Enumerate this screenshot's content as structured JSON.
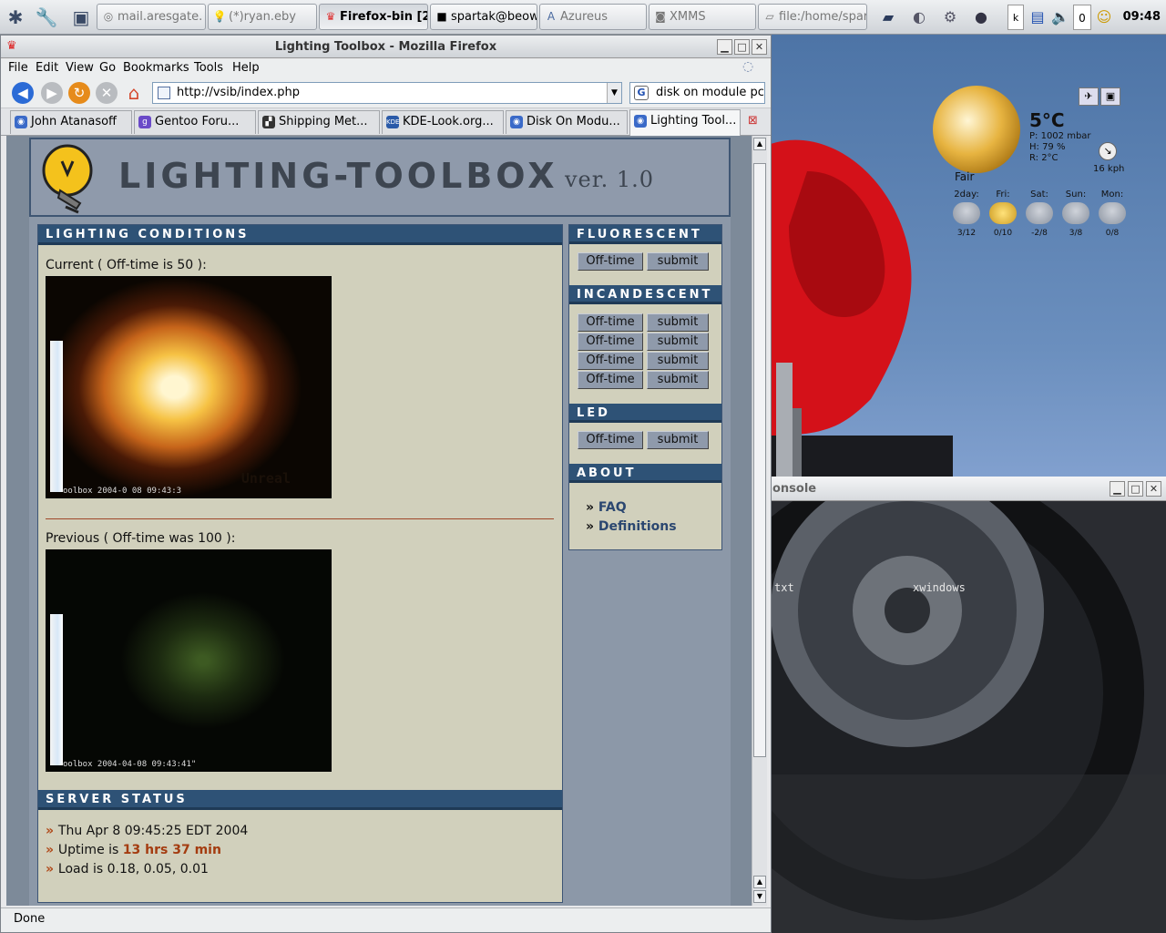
{
  "taskbar": {
    "tasks": [
      {
        "label": "mail.aresgate."
      },
      {
        "label": "(*)ryan.eby"
      },
      {
        "label": "Firefox-bin [2]"
      },
      {
        "label": "spartak@beow"
      },
      {
        "label": "Azureus"
      },
      {
        "label": "XMMS"
      },
      {
        "label": "file:/home/spar"
      }
    ],
    "tray_count": "0",
    "clock": "09:48"
  },
  "weather": {
    "temp": "5°C",
    "pressure": "P: 1002 mbar",
    "humidity": "H: 79 %",
    "feels": "R: 2°C",
    "wind": "16 kph",
    "condition": "Fair",
    "days": [
      {
        "name": "2day:",
        "temps": "3/12"
      },
      {
        "name": "Fri:",
        "temps": "0/10"
      },
      {
        "name": "Sat:",
        "temps": "-2/8"
      },
      {
        "name": "Sun:",
        "temps": "3/8"
      },
      {
        "name": "Mon:",
        "temps": "0/8"
      }
    ]
  },
  "console": {
    "title": "onsole",
    "items": [
      "txt",
      "xwindows"
    ]
  },
  "firefox": {
    "title": "Lighting Toolbox - Mozilla Firefox",
    "menu": [
      {
        "label": "File"
      },
      {
        "label": "Edit"
      },
      {
        "label": "View"
      },
      {
        "label": "Go"
      },
      {
        "label": "Bookmarks"
      },
      {
        "label": "Tools"
      },
      {
        "label": "Help"
      }
    ],
    "url": "http://vsib/index.php",
    "search": "disk on module pc",
    "tabs": [
      {
        "label": "John Atanasoff"
      },
      {
        "label": "Gentoo Foru..."
      },
      {
        "label": "Shipping Met..."
      },
      {
        "label": "KDE-Look.org..."
      },
      {
        "label": "Disk On Modu..."
      },
      {
        "label": "Lighting Tool..."
      }
    ],
    "status": "Done"
  },
  "page": {
    "logo_title": "LIGHTING-TOOLBOX",
    "logo_version": "ver. 1.0",
    "lighting_conditions": {
      "heading": "LIGHTING CONDITIONS",
      "current_label": "Current ( Off-time is 50 ):",
      "current_caption": "oolbox 2004-0 08 09:43:3",
      "current_watermark": "Unreal",
      "previous_label": "Previous ( Off-time was 100 ):",
      "previous_caption": "oolbox 2004-04-08 09:43:41\""
    },
    "server_status": {
      "heading": "SERVER STATUS",
      "date": "Thu Apr 8 09:45:25 EDT 2004",
      "uptime_prefix": "Uptime is ",
      "uptime_value": "13 hrs 37 min",
      "load": "Load is 0.18, 0.05, 0.01"
    },
    "sidebar": {
      "fluorescent": "FLUORESCENT",
      "incandescent": "INCANDESCENT",
      "led": "LED",
      "about": "ABOUT",
      "offtime_label": "Off-time",
      "submit_label": "submit",
      "links": [
        {
          "label": "FAQ"
        },
        {
          "label": "Definitions"
        }
      ]
    }
  }
}
